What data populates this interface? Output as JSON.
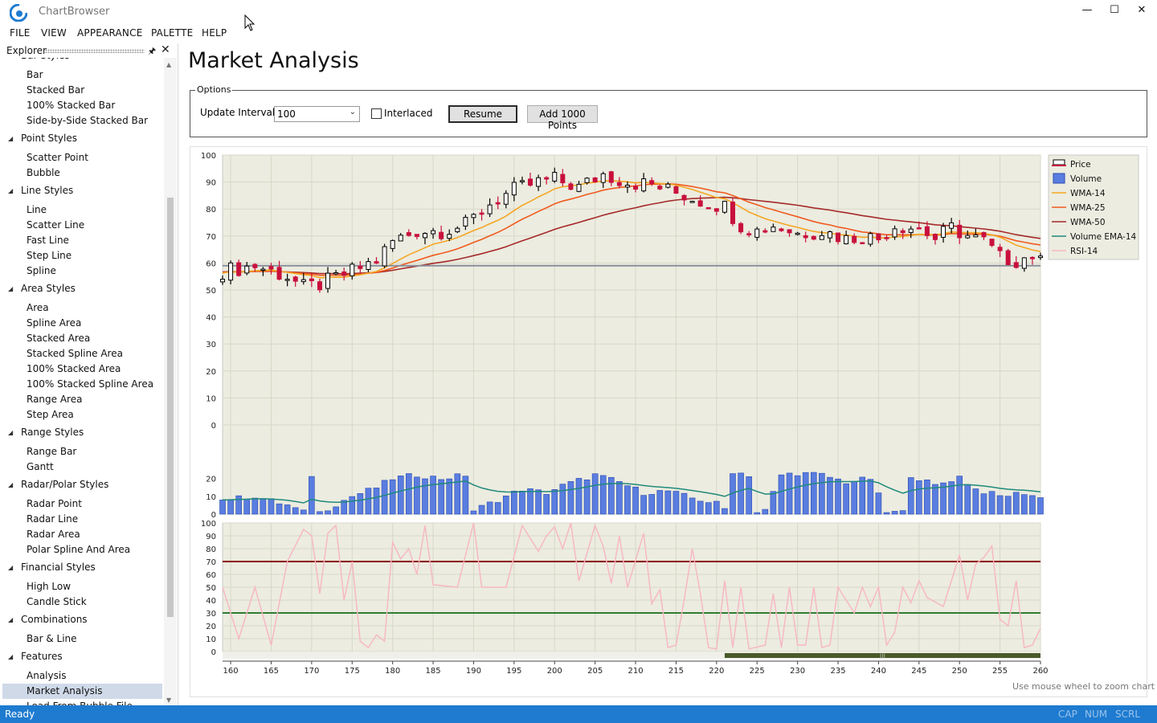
{
  "app": {
    "title": "ChartBrowser",
    "controls": {
      "minimize": "—",
      "maximize": "☐",
      "close": "✕"
    }
  },
  "menu": [
    "FILE",
    "VIEW",
    "APPEARANCE",
    "PALETTE",
    "HELP"
  ],
  "explorer": {
    "title": "Explorer",
    "pin_icon": "📌",
    "close_icon": "✕",
    "partial_top": "Bar Styles",
    "groups": [
      {
        "label": "",
        "items": [
          "Bar",
          "Stacked Bar",
          "100% Stacked Bar",
          "Side-by-Side Stacked Bar"
        ]
      },
      {
        "label": "Point Styles",
        "items": [
          "Scatter Point",
          "Bubble"
        ]
      },
      {
        "label": "Line Styles",
        "items": [
          "Line",
          "Scatter Line",
          "Fast Line",
          "Step Line",
          "Spline"
        ]
      },
      {
        "label": "Area Styles",
        "items": [
          "Area",
          "Spline Area",
          "Stacked Area",
          "Stacked Spline Area",
          "100% Stacked Area",
          "100% Stacked Spline Area",
          "Range Area",
          "Step Area"
        ]
      },
      {
        "label": "Range Styles",
        "items": [
          "Range Bar",
          "Gantt"
        ]
      },
      {
        "label": "Radar/Polar Styles",
        "items": [
          "Radar Point",
          "Radar Line",
          "Radar Area",
          "Polar Spline And Area"
        ]
      },
      {
        "label": "Financial Styles",
        "items": [
          "High Low",
          "Candle Stick"
        ]
      },
      {
        "label": "Combinations",
        "items": [
          "Bar & Line"
        ]
      },
      {
        "label": "Features",
        "items": [
          "Analysis",
          "Market Analysis",
          "Load From Bubble File"
        ]
      }
    ],
    "selected": "Market Analysis"
  },
  "page": {
    "title": "Market Analysis"
  },
  "options": {
    "legend": "Options",
    "interval_label": "Update Interval:",
    "interval_value": "100",
    "interlaced_label": "Interlaced",
    "interlaced_checked": false,
    "resume_label": "Resume",
    "add_points_label": "Add 1000 Points"
  },
  "zoom_hint": "Use mouse wheel to zoom chart",
  "status": {
    "text": "Ready",
    "keys": [
      "CAP",
      "NUM",
      "SCRL"
    ]
  },
  "colors": {
    "up": "#000000",
    "down": "#c8103c",
    "volume": "#5a7de0",
    "wma14": "#f5a623",
    "wma25": "#f05a1e",
    "wma50": "#a52a2a",
    "volume_ema": "#1f8a7a",
    "rsi": "#f7b8c4",
    "plot_bg": "#ecece0",
    "rsi_upper": "#8b0000",
    "rsi_lower": "#2e7d32",
    "accent": "#1e7bd0"
  },
  "chart_data": {
    "type": "stock",
    "x": {
      "range": [
        159,
        260
      ],
      "ticks": [
        160,
        165,
        170,
        175,
        180,
        185,
        190,
        195,
        200,
        205,
        210,
        215,
        220,
        225,
        230,
        235,
        240,
        245,
        250,
        255,
        260
      ]
    },
    "price_axis": {
      "range": [
        0,
        100
      ],
      "ticks": [
        0,
        10,
        20,
        30,
        40,
        50,
        60,
        70,
        80,
        90,
        100
      ]
    },
    "volume_axis": {
      "range": [
        0,
        50
      ],
      "ticks": [
        0,
        10,
        20
      ]
    },
    "rsi_axis": {
      "range": [
        0,
        100
      ],
      "ticks": [
        0,
        10,
        20,
        30,
        40,
        50,
        60,
        70,
        80,
        90,
        100
      ]
    },
    "rsi_levels": [
      70,
      30
    ],
    "reference_line": 59,
    "legend": [
      "Price",
      "Volume",
      "WMA-14",
      "WMA-25",
      "WMA-50",
      "Volume EMA-14",
      "RSI-14"
    ],
    "price_keypoints": [
      [
        159,
        57
      ],
      [
        163,
        59
      ],
      [
        167,
        55
      ],
      [
        169,
        51
      ],
      [
        171,
        52
      ],
      [
        175,
        57
      ],
      [
        178,
        61
      ],
      [
        180,
        68
      ],
      [
        183,
        72
      ],
      [
        186,
        72
      ],
      [
        189,
        74
      ],
      [
        192,
        82
      ],
      [
        195,
        87
      ],
      [
        198,
        90
      ],
      [
        200,
        91
      ],
      [
        203,
        88
      ],
      [
        206,
        93
      ],
      [
        209,
        90
      ],
      [
        212,
        89
      ],
      [
        215,
        86
      ],
      [
        218,
        83
      ],
      [
        221,
        81
      ],
      [
        223,
        74
      ],
      [
        225,
        72
      ],
      [
        227,
        74
      ],
      [
        230,
        71
      ],
      [
        233,
        72
      ],
      [
        236,
        69
      ],
      [
        238,
        70
      ],
      [
        240,
        69
      ],
      [
        242,
        74
      ],
      [
        245,
        73
      ],
      [
        247,
        69
      ],
      [
        249,
        73
      ],
      [
        251,
        70
      ],
      [
        253,
        68
      ],
      [
        255,
        62
      ],
      [
        257,
        61
      ],
      [
        259,
        63
      ],
      [
        260,
        60
      ]
    ],
    "volume_keypoints": [
      [
        159,
        8
      ],
      [
        163,
        10
      ],
      [
        167,
        5
      ],
      [
        169,
        1
      ],
      [
        170,
        22
      ],
      [
        171,
        1
      ],
      [
        175,
        10
      ],
      [
        178,
        15
      ],
      [
        180,
        20
      ],
      [
        183,
        22
      ],
      [
        186,
        20
      ],
      [
        189,
        22
      ],
      [
        190,
        2
      ],
      [
        193,
        8
      ],
      [
        196,
        14
      ],
      [
        199,
        12
      ],
      [
        201,
        16
      ],
      [
        205,
        22
      ],
      [
        208,
        18
      ],
      [
        211,
        12
      ],
      [
        214,
        13
      ],
      [
        217,
        9
      ],
      [
        220,
        6
      ],
      [
        221,
        3
      ],
      [
        222,
        24
      ],
      [
        224,
        22
      ],
      [
        225,
        1
      ],
      [
        226,
        2
      ],
      [
        228,
        22
      ],
      [
        230,
        23
      ],
      [
        233,
        22
      ],
      [
        236,
        18
      ],
      [
        239,
        20
      ],
      [
        241,
        1
      ],
      [
        243,
        1
      ],
      [
        244,
        22
      ],
      [
        247,
        16
      ],
      [
        250,
        21
      ],
      [
        252,
        14
      ],
      [
        255,
        10
      ],
      [
        258,
        12
      ],
      [
        260,
        9
      ]
    ],
    "rsi_keypoints": [
      [
        159,
        50
      ],
      [
        161,
        10
      ],
      [
        163,
        50
      ],
      [
        165,
        5
      ],
      [
        167,
        70
      ],
      [
        169,
        95
      ],
      [
        170,
        90
      ],
      [
        171,
        45
      ],
      [
        172,
        92
      ],
      [
        173,
        98
      ],
      [
        174,
        40
      ],
      [
        175,
        70
      ],
      [
        176,
        8
      ],
      [
        177,
        3
      ],
      [
        178,
        13
      ],
      [
        179,
        8
      ],
      [
        180,
        85
      ],
      [
        181,
        72
      ],
      [
        182,
        80
      ],
      [
        183,
        60
      ],
      [
        184,
        98
      ],
      [
        185,
        52
      ],
      [
        188,
        50
      ],
      [
        190,
        100
      ],
      [
        191,
        50
      ],
      [
        194,
        50
      ],
      [
        196,
        98
      ],
      [
        198,
        78
      ],
      [
        199,
        90
      ],
      [
        200,
        97
      ],
      [
        201,
        80
      ],
      [
        202,
        100
      ],
      [
        203,
        55
      ],
      [
        205,
        98
      ],
      [
        206,
        82
      ],
      [
        207,
        53
      ],
      [
        208,
        90
      ],
      [
        209,
        50
      ],
      [
        211,
        92
      ],
      [
        212,
        37
      ],
      [
        213,
        48
      ],
      [
        214,
        3
      ],
      [
        215,
        5
      ],
      [
        216,
        40
      ],
      [
        217,
        80
      ],
      [
        218,
        45
      ],
      [
        219,
        3
      ],
      [
        220,
        2
      ],
      [
        221,
        55
      ],
      [
        222,
        3
      ],
      [
        223,
        50
      ],
      [
        224,
        2
      ],
      [
        226,
        5
      ],
      [
        227,
        45
      ],
      [
        228,
        3
      ],
      [
        229,
        50
      ],
      [
        230,
        5
      ],
      [
        231,
        5
      ],
      [
        232,
        50
      ],
      [
        233,
        3
      ],
      [
        234,
        5
      ],
      [
        235,
        50
      ],
      [
        236,
        40
      ],
      [
        237,
        30
      ],
      [
        238,
        50
      ],
      [
        239,
        35
      ],
      [
        240,
        50
      ],
      [
        241,
        5
      ],
      [
        242,
        15
      ],
      [
        243,
        50
      ],
      [
        244,
        38
      ],
      [
        245,
        55
      ],
      [
        246,
        42
      ],
      [
        248,
        35
      ],
      [
        250,
        75
      ],
      [
        251,
        40
      ],
      [
        252,
        68
      ],
      [
        253,
        73
      ],
      [
        254,
        82
      ],
      [
        255,
        25
      ],
      [
        256,
        20
      ],
      [
        257,
        55
      ],
      [
        258,
        3
      ],
      [
        259,
        5
      ],
      [
        260,
        18
      ]
    ]
  }
}
